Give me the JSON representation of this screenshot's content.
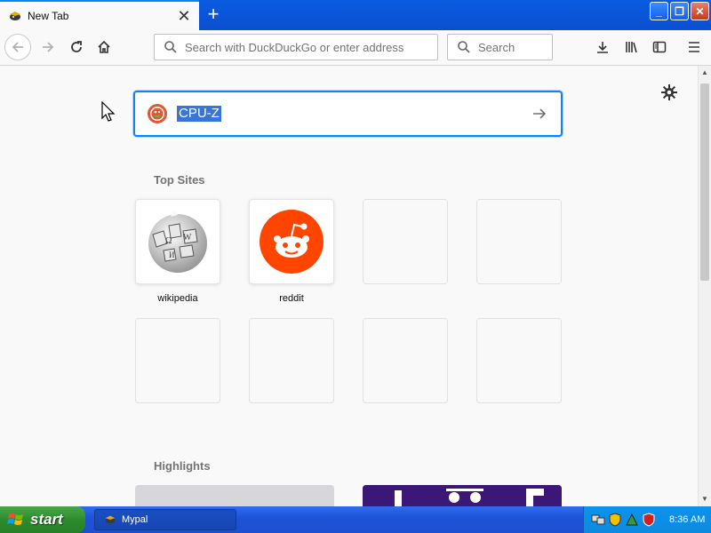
{
  "browser": {
    "tab": {
      "title": "New Tab",
      "close_glyph": "✕"
    },
    "new_tab_glyph": "+",
    "window_buttons": {
      "minimize": "_",
      "restore": "❐",
      "close": "✕"
    },
    "urlbar": {
      "placeholder": "Search with DuckDuckGo or enter address",
      "value": ""
    },
    "searchbar": {
      "placeholder": "Search",
      "value": ""
    }
  },
  "newtab": {
    "search": {
      "query": "CPU-Z",
      "engine_icon": "duckduckgo-icon"
    },
    "top_sites_title": "Top Sites",
    "top_sites": [
      {
        "label": "wikipedia",
        "icon": "wikipedia-icon"
      },
      {
        "label": "reddit",
        "icon": "reddit-icon"
      },
      {
        "label": "",
        "icon": ""
      },
      {
        "label": "",
        "icon": ""
      },
      {
        "label": "",
        "icon": ""
      },
      {
        "label": "",
        "icon": ""
      },
      {
        "label": "",
        "icon": ""
      },
      {
        "label": "",
        "icon": ""
      }
    ],
    "highlights_title": "Highlights"
  },
  "taskbar": {
    "start_label": "start",
    "task_label": "Mypal",
    "clock": "8:36 AM"
  },
  "colors": {
    "accent": "#0a84ff",
    "reddit": "#ff4500",
    "taskbar": "#1f53d8",
    "start": "#2c8b2c"
  }
}
